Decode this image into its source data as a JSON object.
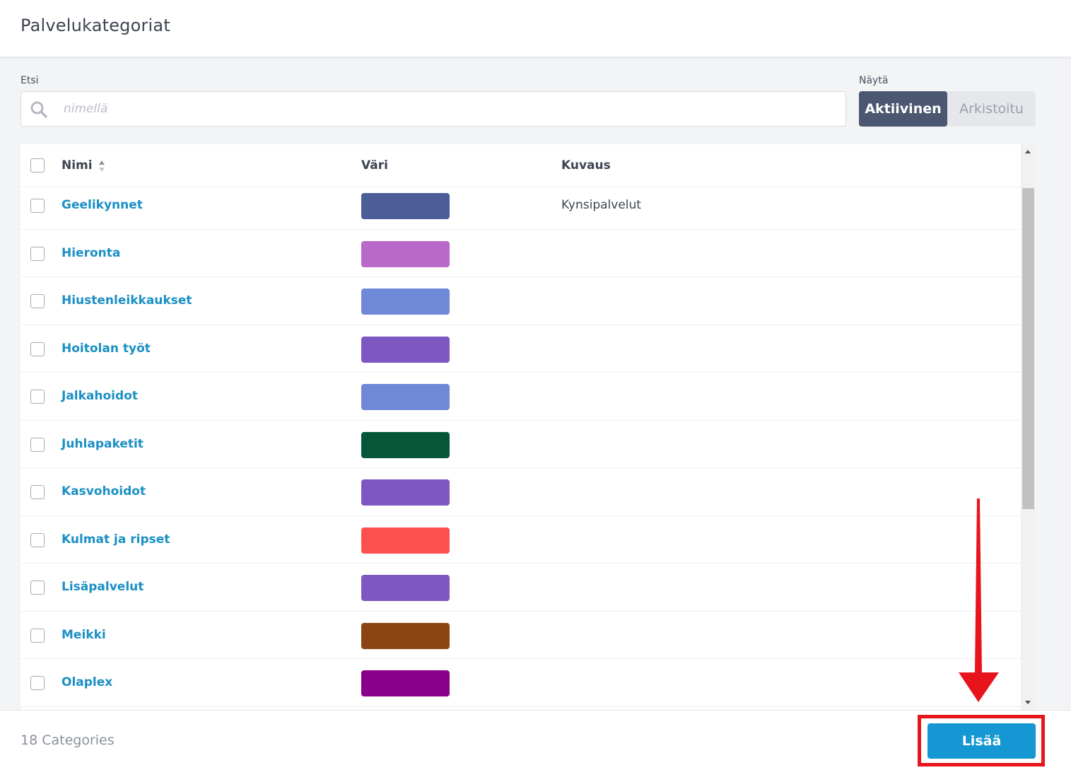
{
  "header": {
    "title": "Palvelukategoriat"
  },
  "search": {
    "label": "Etsi",
    "placeholder": "nimellä",
    "value": ""
  },
  "filter": {
    "label": "Näytä",
    "options": [
      "Aktiivinen",
      "Arkistoitu"
    ],
    "selected": "Aktiivinen"
  },
  "table": {
    "columns": {
      "name": "Nimi",
      "color": "Väri",
      "description": "Kuvaus"
    },
    "rows": [
      {
        "name": "Geelikynnet",
        "color": "#4c5e97",
        "description": "Kynsipalvelut"
      },
      {
        "name": "Hieronta",
        "color": "#b96ac8",
        "description": ""
      },
      {
        "name": "Hiustenleikkaukset",
        "color": "#7089d6",
        "description": ""
      },
      {
        "name": "Hoitolan työt",
        "color": "#7e57c2",
        "description": ""
      },
      {
        "name": "Jalkahoidot",
        "color": "#7089d6",
        "description": ""
      },
      {
        "name": "Juhlapaketit",
        "color": "#06573a",
        "description": ""
      },
      {
        "name": "Kasvohoidot",
        "color": "#7e57c2",
        "description": ""
      },
      {
        "name": "Kulmat ja ripset",
        "color": "#ff5050",
        "description": ""
      },
      {
        "name": "Lisäpalvelut",
        "color": "#7e57c2",
        "description": ""
      },
      {
        "name": "Meikki",
        "color": "#8b4513",
        "description": ""
      },
      {
        "name": "Olaplex",
        "color": "#8b008b",
        "description": ""
      }
    ]
  },
  "footer": {
    "count_text": "18 Categories",
    "add_label": "Lisää"
  },
  "annotation": {
    "color": "#e8141c"
  }
}
